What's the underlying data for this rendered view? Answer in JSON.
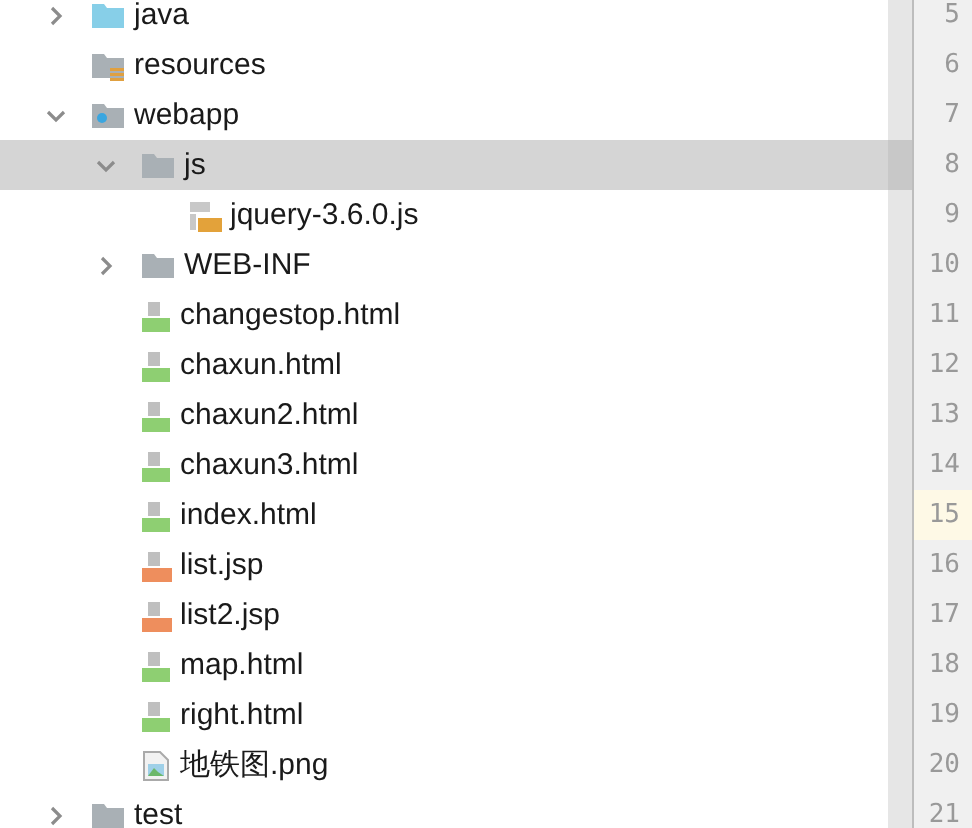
{
  "tree": [
    {
      "children": [
        {
          "label": "java",
          "kind": "source-folder",
          "expanded": false,
          "selected": false
        },
        {
          "label": "resources",
          "kind": "resources-folder",
          "selected": false
        },
        {
          "label": "webapp",
          "kind": "web-folder",
          "expanded": true,
          "selected": false,
          "children": [
            {
              "label": "js",
              "kind": "folder",
              "expanded": true,
              "selected": true,
              "children": [
                {
                  "label": "jquery-3.6.0.js",
                  "kind": "js",
                  "selected": false
                }
              ]
            },
            {
              "label": "WEB-INF",
              "kind": "folder",
              "expanded": false,
              "selected": false
            },
            {
              "label": "changestop.html",
              "kind": "html",
              "selected": false
            },
            {
              "label": "chaxun.html",
              "kind": "html",
              "selected": false
            },
            {
              "label": "chaxun2.html",
              "kind": "html",
              "selected": false
            },
            {
              "label": "chaxun3.html",
              "kind": "html",
              "selected": false
            },
            {
              "label": "index.html",
              "kind": "html",
              "selected": false
            },
            {
              "label": "list.jsp",
              "kind": "jsp",
              "selected": false
            },
            {
              "label": "list2.jsp",
              "kind": "jsp",
              "selected": false
            },
            {
              "label": "map.html",
              "kind": "html",
              "selected": false
            },
            {
              "label": "right.html",
              "kind": "html",
              "selected": false
            },
            {
              "label": "地铁图.png",
              "kind": "image",
              "selected": false
            }
          ]
        }
      ]
    },
    {
      "label": "test",
      "kind": "folder",
      "expanded": false,
      "selected": false
    }
  ],
  "gutter": [
    {
      "number": "5",
      "current": false
    },
    {
      "number": "6",
      "current": false
    },
    {
      "number": "7",
      "current": false
    },
    {
      "number": "8",
      "current": false
    },
    {
      "number": "9",
      "current": false
    },
    {
      "number": "10",
      "current": false
    },
    {
      "number": "11",
      "current": false
    },
    {
      "number": "12",
      "current": false
    },
    {
      "number": "13",
      "current": false
    },
    {
      "number": "14",
      "current": false
    },
    {
      "number": "15",
      "current": true
    },
    {
      "number": "16",
      "current": false
    },
    {
      "number": "17",
      "current": false
    },
    {
      "number": "18",
      "current": false
    },
    {
      "number": "19",
      "current": false
    },
    {
      "number": "20",
      "current": false
    },
    {
      "number": "21",
      "current": false
    }
  ]
}
